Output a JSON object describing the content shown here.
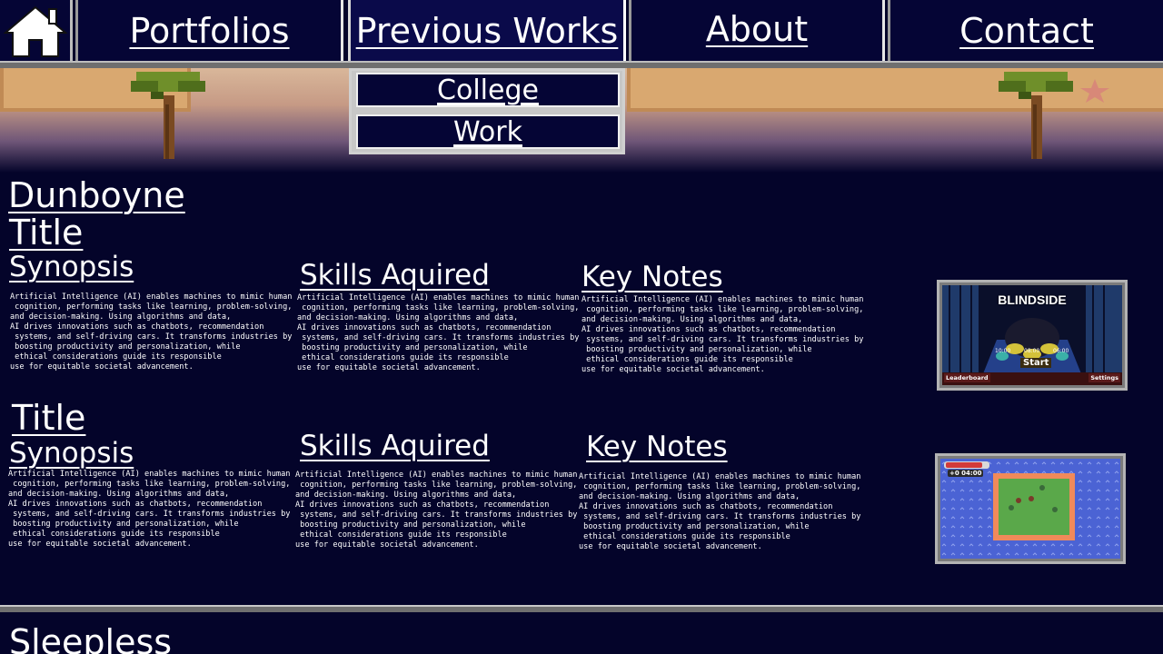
{
  "nav": {
    "home_icon": "home-icon",
    "items": [
      {
        "label": "Portfolios"
      },
      {
        "label": "Previous Works"
      },
      {
        "label": "About"
      },
      {
        "label": "Contact"
      }
    ]
  },
  "dropdown": {
    "items": [
      {
        "label": "College"
      },
      {
        "label": "Work"
      }
    ]
  },
  "main": {
    "section_title": "Dunboyne",
    "projects": [
      {
        "title": "Title",
        "synopsis_heading": "Synopsis",
        "synopsis_text": "Artificial Intelligence (AI) enables machines to mimic human\n cognition, performing tasks like learning, problem-solving,\nand decision-making. Using algorithms and data,\nAI drives innovations such as chatbots, recommendation\n systems, and self-driving cars. It transforms industries by\n boosting productivity and personalization, while\n ethical considerations guide its responsible\nuse for equitable societal advancement.",
        "skills_heading": "Skills Aquired",
        "skills_text": "Artificial Intelligence (AI) enables machines to mimic human\n cognition, performing tasks like learning, problem-solving,\nand decision-making. Using algorithms and data,\nAI drives innovations such as chatbots, recommendation\n systems, and self-driving cars. It transforms industries by\n boosting productivity and personalization, while\n ethical considerations guide its responsible\nuse for equitable societal advancement.",
        "notes_heading": "Key Notes",
        "notes_text": "Artificial Intelligence (AI) enables machines to mimic human\n cognition, performing tasks like learning, problem-solving,\nand decision-making. Using algorithms and data,\nAI drives innovations such as chatbots, recommendation\n systems, and self-driving cars. It transforms industries by\n boosting productivity and personalization, while\n ethical considerations guide its responsible\nuse for equitable societal advancement.",
        "thumbnail": {
          "game_title": "BLINDSIDE",
          "start_label": "Start",
          "leaderboard_label": "Leaderboard",
          "settings_label": "Settings",
          "score_left": "10:00",
          "score_mid": "08:00",
          "score_right": "06:00"
        }
      },
      {
        "title": "Title",
        "synopsis_heading": "Synopsis",
        "synopsis_text": "Artificial Intelligence (AI) enables machines to mimic human\n cognition, performing tasks like learning, problem-solving,\nand decision-making. Using algorithms and data,\nAI drives innovations such as chatbots, recommendation\n systems, and self-driving cars. It transforms industries by\n boosting productivity and personalization, while\n ethical considerations guide its responsible\nuse for equitable societal advancement.",
        "skills_heading": "Skills Aquired",
        "skills_text": "Artificial Intelligence (AI) enables machines to mimic human\n cognition, performing tasks like learning, problem-solving,\nand decision-making. Using algorithms and data,\nAI drives innovations such as chatbots, recommendation\n systems, and self-driving cars. It transforms industries by\n boosting productivity and personalization, while\n ethical considerations guide its responsible\nuse for equitable societal advancement.",
        "notes_heading": "Key Notes",
        "notes_text": "Artificial Intelligence (AI) enables machines to mimic human\n cognition, performing tasks like learning, problem-solving,\nand decision-making. Using algorithms and data,\nAI drives innovations such as chatbots, recommendation\n systems, and self-driving cars. It transforms industries by\n boosting productivity and personalization, while\n ethical considerations guide its responsible\nuse for equitable societal advancement.",
        "thumbnail": {
          "timer": "+0 04:00"
        }
      }
    ],
    "next_section_title": "Sleepless"
  },
  "colors": {
    "background": "#04042a",
    "nav_cell": "#050535",
    "text": "#ffffff",
    "border_light": "#e6e6e6",
    "border_dark": "#6f6f6f"
  }
}
